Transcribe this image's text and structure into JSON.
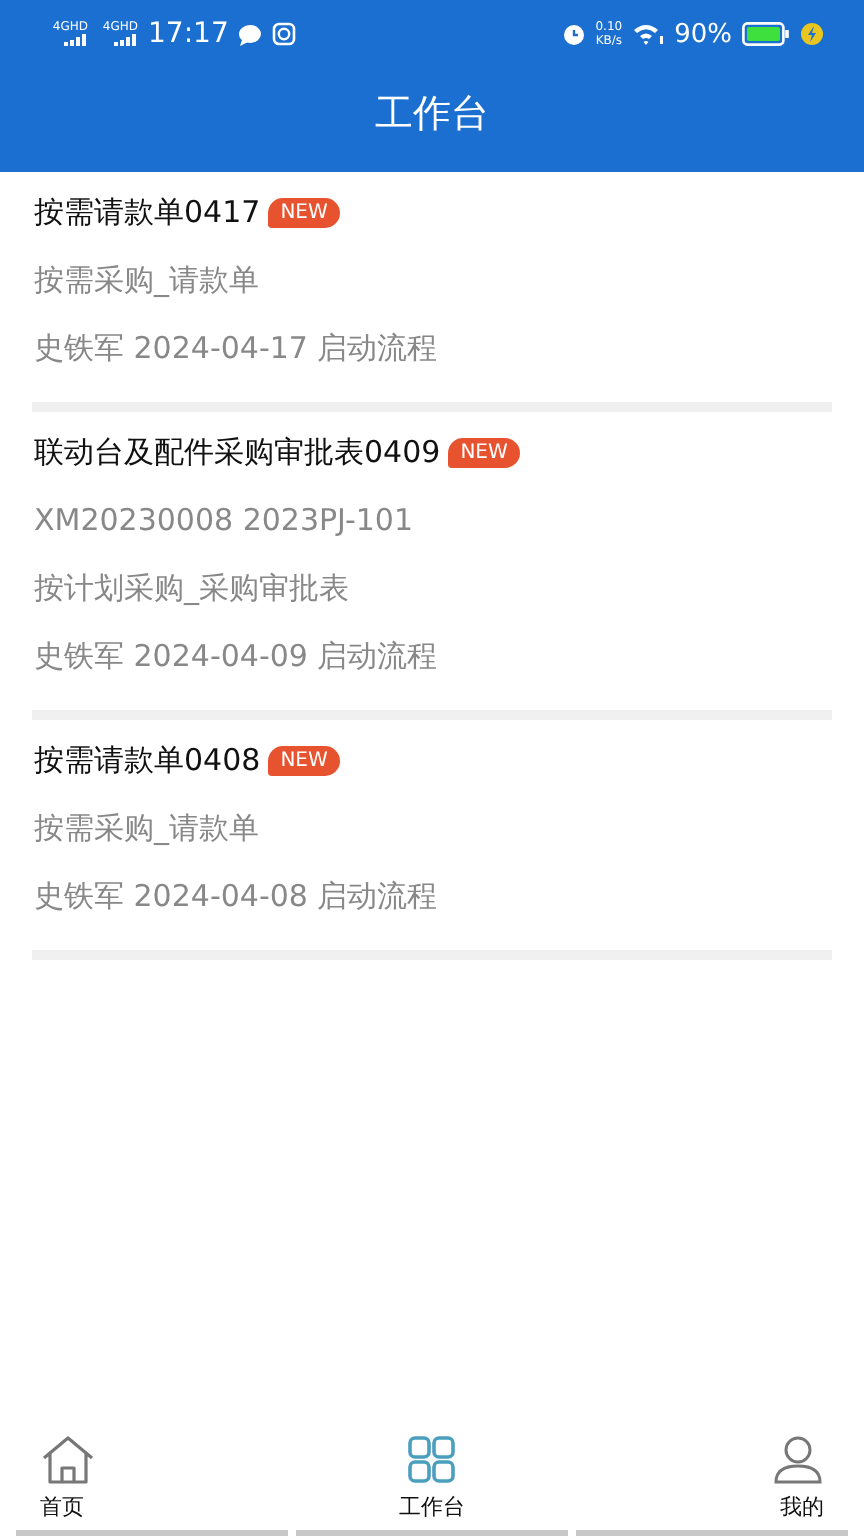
{
  "status_bar": {
    "network_1": "4GHD",
    "network_2": "4GHD",
    "time": "17:17",
    "speed_value": "0.10",
    "speed_unit": "KB/s",
    "battery": "90%"
  },
  "header": {
    "title": "工作台"
  },
  "tasks": [
    {
      "title": "按需请款单0417",
      "badge": "NEW",
      "lines": [
        "按需采购_请款单",
        "史铁军 2024-04-17 启动流程"
      ]
    },
    {
      "title": "联动台及配件采购审批表0409",
      "badge": "NEW",
      "lines": [
        "XM20230008 2023PJ-101",
        "按计划采购_采购审批表",
        "史铁军 2024-04-09 启动流程"
      ]
    },
    {
      "title": "按需请款单0408",
      "badge": "NEW",
      "lines": [
        "按需采购_请款单",
        "史铁军 2024-04-08 启动流程"
      ]
    }
  ],
  "tabs": [
    {
      "kind": "home",
      "label": "首页",
      "selected": false
    },
    {
      "kind": "grid",
      "label": "工作台",
      "selected": true
    },
    {
      "kind": "person",
      "label": "我的",
      "selected": false
    }
  ]
}
